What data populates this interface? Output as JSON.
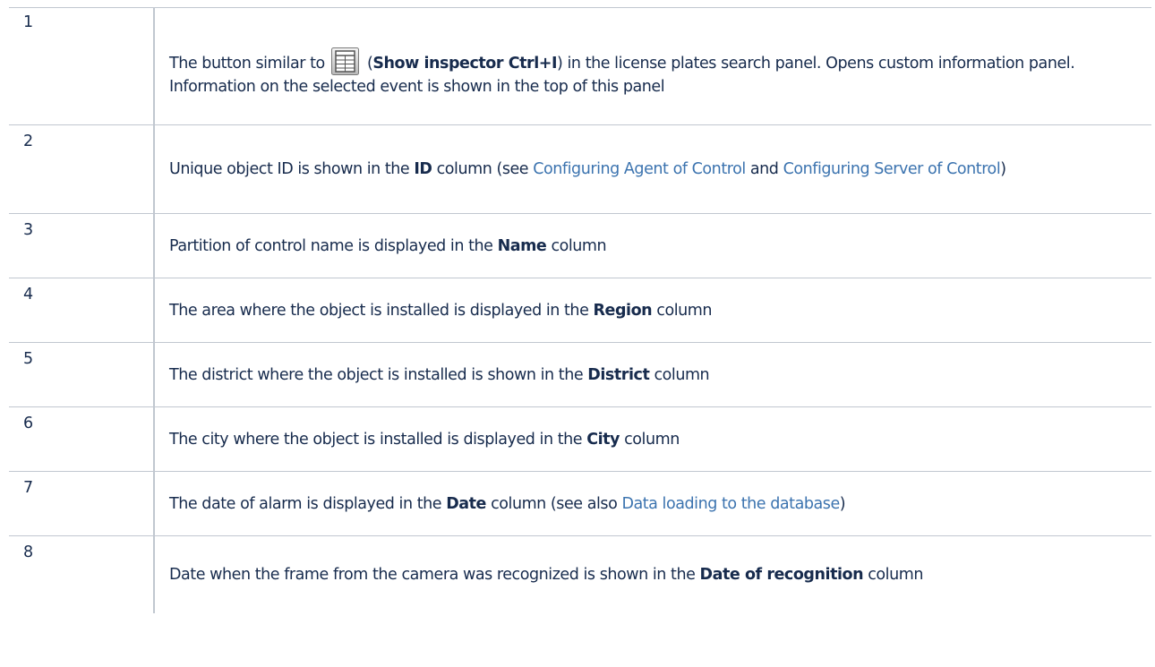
{
  "rows": [
    {
      "num": "1",
      "text_before_icon": "The button similar to ",
      "text_after_icon_open": " (",
      "bold": "Show inspector Ctrl+I",
      "text_after_bold": ") in the license plates search panel. Opens custom information panel. Information on the selected event is shown in the top of this panel",
      "icon": "inspector-icon"
    },
    {
      "num": "2",
      "text_before_bold": "Unique object ID is shown in the ",
      "bold": "ID",
      "text_after_bold": " column (see ",
      "link1": "Configuring Agent of Control",
      "text_between_links": " and ",
      "link2": "Configuring Server of Control",
      "text_end": ")"
    },
    {
      "num": "3",
      "text_before_bold": "Partition of control name is displayed in the ",
      "bold": "Name",
      "text_after_bold": " column"
    },
    {
      "num": "4",
      "text_before_bold": "The area where the object is installed is displayed in the ",
      "bold": "Region",
      "text_after_bold": " column"
    },
    {
      "num": "5",
      "text_before_bold": "The district where the object is installed is shown in the ",
      "bold": "District",
      "text_after_bold": " column"
    },
    {
      "num": "6",
      "text_before_bold": "The city where the object is installed is displayed in the ",
      "bold": "City",
      "text_after_bold": " column"
    },
    {
      "num": "7",
      "text_before_bold": "The date of alarm is displayed in the ",
      "bold": "Date",
      "text_after_bold": " column (see also ",
      "link1": "Data loading to the database",
      "text_end": ")"
    },
    {
      "num": "8",
      "text_before_bold": "Date when the frame from the camera was recognized is shown in the ",
      "bold": "Date of recognition",
      "text_after_bold": " column"
    }
  ],
  "colors": {
    "text": "#172b4d",
    "link": "#3b73af",
    "border": "#c1c7d0"
  }
}
